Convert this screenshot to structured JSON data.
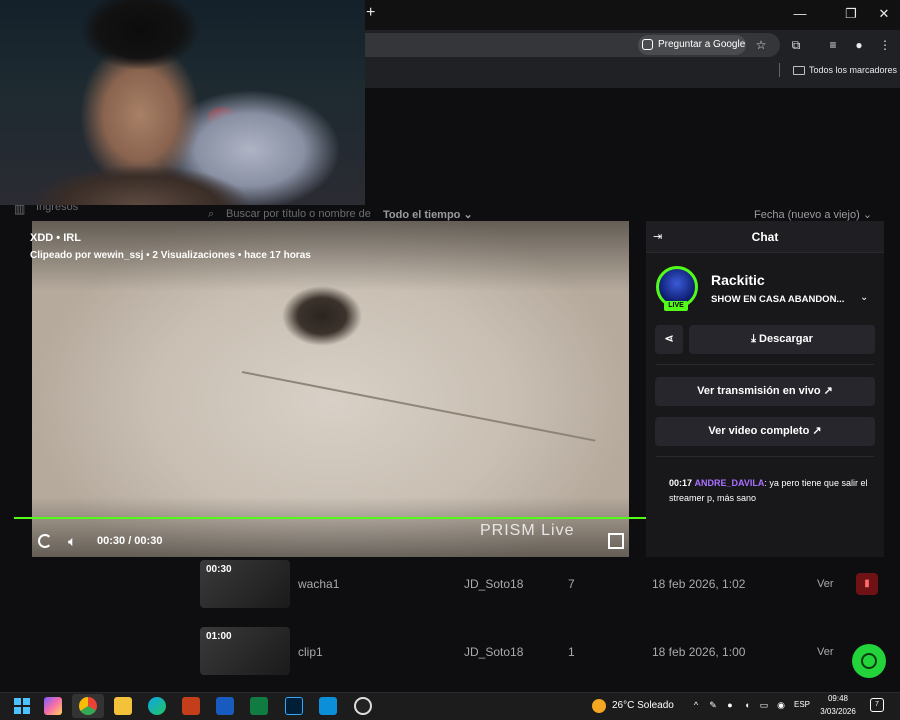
{
  "browser": {
    "new_tab_label": "+",
    "ask_google_label": "Preguntar a Google",
    "bookmarks_label": "Todos los marcadores"
  },
  "background_page": {
    "sidebar_section": "Ingresos",
    "search_placeholder": "Buscar por título o nombre de",
    "time_filter": "Todo el tiempo",
    "sort_filter": "Fecha (nuevo a viejo)",
    "rows": [
      {
        "duration": "00:30",
        "title": "wacha1",
        "author": "JD_Soto18",
        "views": "7",
        "date": "18 feb 2026, 1:02",
        "action": "Ver"
      },
      {
        "duration": "01:00",
        "title": "clip1",
        "author": "JD_Soto18",
        "views": "1",
        "date": "18 feb 2026, 1:00",
        "action": "Ver"
      }
    ]
  },
  "player": {
    "clip_title": "XDD • IRL",
    "clip_meta": "Clipeado por wewin_ssj • 2 Visualizaciones • hace 17 horas",
    "time": "00:30 / 00:30",
    "watermark": "PRISM Live",
    "progress": 1.0
  },
  "side_panel": {
    "header": "Chat",
    "streamer_name": "Rackitic",
    "live_badge": "LIVE",
    "stream_title": "SHOW EN CASA ABANDON...",
    "download_label": "Descargar",
    "watch_live_label": "Ver transmisión en vivo",
    "watch_full_label": "Ver video completo",
    "chat": [
      {
        "time": "00:17",
        "user": "ANDRE_DAVILA",
        "text": ": ya pero tiene que salir el streamer p, más sano"
      }
    ]
  },
  "taskbar": {
    "weather": "26°C  Soleado",
    "lang": "ESP",
    "clock_time": "09:48",
    "clock_date": "3/03/2026",
    "notifications": "7"
  },
  "colors": {
    "accent_green": "#53fc18",
    "chat_user": "#a970ff",
    "panel_bg": "#18181b",
    "delete_red": "#6e1215"
  }
}
